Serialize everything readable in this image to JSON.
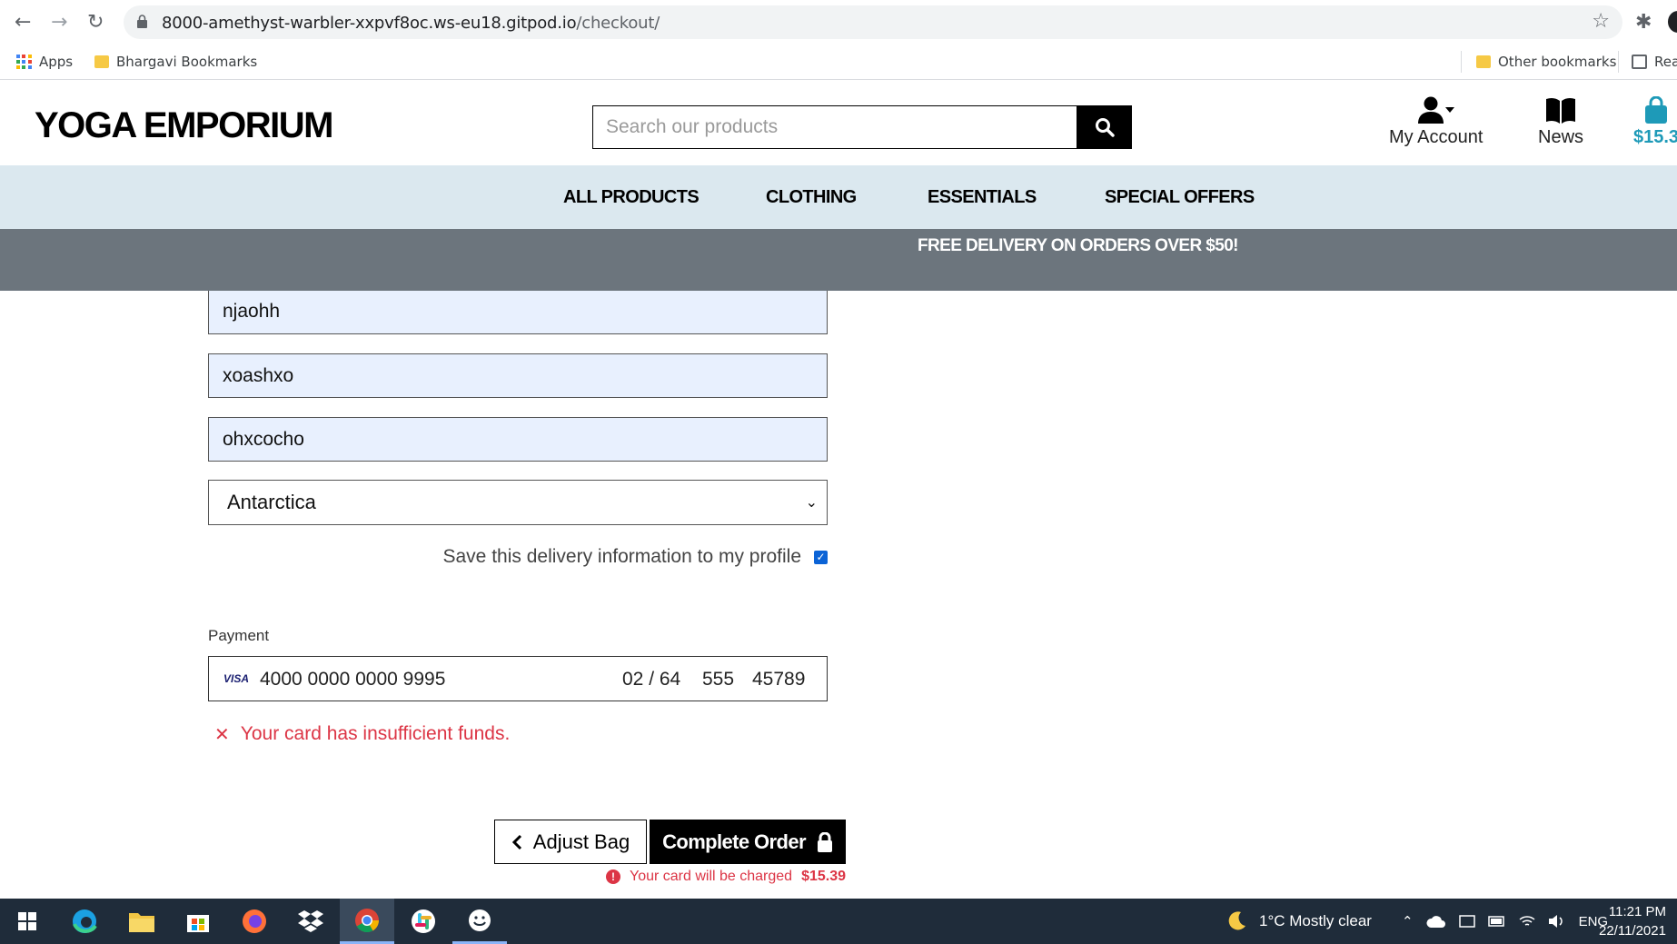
{
  "browser": {
    "url_host": "8000-amethyst-warbler-xxpvf8oc.ws-eu18.gitpod.io",
    "url_path": "/checkout/",
    "bookmarks": {
      "apps": "Apps",
      "bhargavi": "Bhargavi Bookmarks",
      "other": "Other bookmarks",
      "reading_list": "Rea"
    }
  },
  "site": {
    "logo": "YOGA EMPORIUM",
    "search_placeholder": "Search our products",
    "account_label": "My Account",
    "news_label": "News",
    "bag_total": "$15.3"
  },
  "nav": {
    "items": [
      "ALL PRODUCTS",
      "CLOTHING",
      "ESSENTIALS",
      "SPECIAL OFFERS"
    ]
  },
  "banner": "FREE DELIVERY ON ORDERS OVER $50!",
  "form": {
    "field1": "njaohh",
    "field2": "xoashxo",
    "field3": "ohxcocho",
    "country": "Antarctica",
    "save_label": "Save this delivery information to my profile",
    "save_checked": true
  },
  "payment": {
    "label": "Payment",
    "brand": "VISA",
    "card_number": "4000 0000 0000 9995",
    "expiry": "02 / 64",
    "cvc": "555",
    "zip": "45789",
    "error": "Your card has insufficient funds."
  },
  "actions": {
    "adjust_label": "Adjust Bag",
    "complete_label": "Complete Order",
    "charge_text": "Your card will be charged",
    "charge_amount": "$15.39"
  },
  "taskbar": {
    "weather": "1°C  Mostly clear",
    "lang": "ENG",
    "time": "11:21 PM",
    "date": "22/11/2021"
  },
  "colors": {
    "nav_bg": "#dbe8ef",
    "banner_bg": "#6c757d",
    "bag_accent": "#1e9ab8",
    "error": "#dc3545",
    "autofill_bg": "#e8f0fe"
  }
}
